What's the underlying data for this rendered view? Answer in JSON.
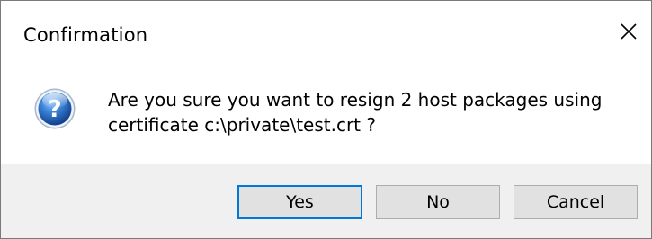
{
  "window": {
    "title": "Confirmation",
    "close_icon": "close-icon"
  },
  "message": {
    "icon": "question-icon",
    "line1": "Are you sure you want to resign 2 host packages using",
    "line2": "certificate c:\\private\\test.crt ?"
  },
  "buttons": {
    "yes": "Yes",
    "no": "No",
    "cancel": "Cancel"
  },
  "colors": {
    "default_button_border": "#0078d7",
    "footer_background": "#f0f0f0",
    "icon_blue": "#1f5fb8"
  }
}
